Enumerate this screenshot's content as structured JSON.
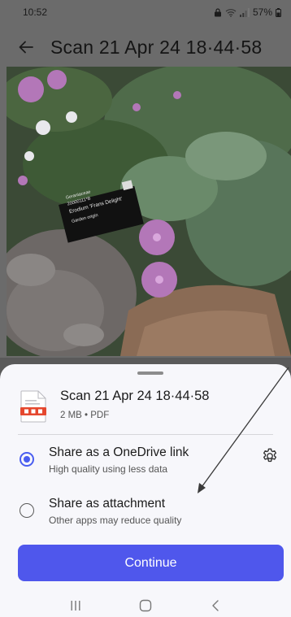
{
  "status_bar": {
    "time": "10:52",
    "battery": "57%"
  },
  "app_bar": {
    "title": "Scan 21 Apr 24 18·44·58"
  },
  "photo": {
    "plant_label_lines": [
      "Geraniaceae",
      "20000111*B",
      "Erodium 'Frans Delight'",
      "Garden origin"
    ]
  },
  "sheet": {
    "file": {
      "name": "Scan 21 Apr 24 18·44·58",
      "meta": "2 MB • PDF"
    },
    "options": [
      {
        "title": "Share as a OneDrive link",
        "subtitle": "High quality using less data",
        "selected": true
      },
      {
        "title": "Share as attachment",
        "subtitle": "Other apps may reduce quality",
        "selected": false
      }
    ],
    "continue_label": "Continue"
  },
  "colors": {
    "accent": "#4f57ec",
    "sheet_bg": "#f7f7fb",
    "pdf_icon": "#e5482f"
  },
  "icons": {
    "back": "arrow-left-icon",
    "settings": "gear-icon",
    "file": "pdf-file-icon",
    "nav_recent": "recent-apps-icon",
    "nav_home": "home-icon",
    "nav_back": "chevron-left-icon"
  }
}
